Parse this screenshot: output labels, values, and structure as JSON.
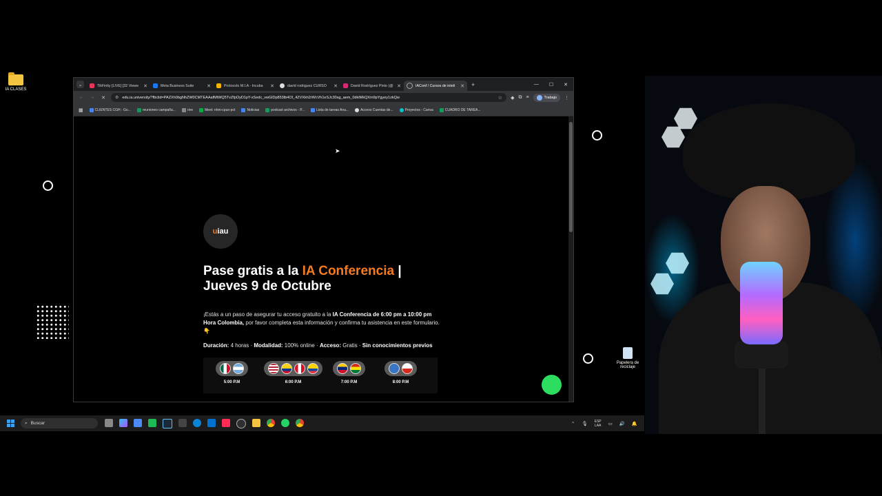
{
  "desktop": {
    "folder_label": "IA CLASES",
    "recycle_label": "Papelera de reciclaje"
  },
  "browser": {
    "tabs": [
      {
        "label": "TikFinity [LIVE] [32 Viewe",
        "color": "#e8335b"
      },
      {
        "label": "Meta Business Suite",
        "color": "#1877f2"
      },
      {
        "label": "Protocolo M.I.A - Incuba",
        "color": "#f5b400"
      },
      {
        "label": "david rodriguez CURSO",
        "color": "#dddddd"
      },
      {
        "label": "David Rodríguez Pinto (@",
        "color": "#d62976"
      },
      {
        "label": "IAConf / Cursos de inteli",
        "color": "#aaaaaa"
      }
    ],
    "address_url": "edu.ia.university/?fbclid=PAZXh0bgNhZW0CMTEAAafMtWQ5TvZfpOyD1pY-xSedc_vwGlDp853tb4OI_4ZVXkh2rWcVh1eSJc30sg_aem_0dkIMkQXm9pYgyey1zkQw",
    "profile_label": "Trabajo",
    "bookmarks": [
      {
        "label": "CLIENTES CGH - Go...",
        "color": "#4285f4"
      },
      {
        "label": "reuniones campaña...",
        "color": "#0f9d58"
      },
      {
        "label": "rive",
        "color": "#888888"
      },
      {
        "label": "Meet: nhm-cpuo-pct",
        "color": "#00ac47"
      },
      {
        "label": "Noticias",
        "color": "#4285f4"
      },
      {
        "label": "podcast archivos - P...",
        "color": "#0f9d58"
      },
      {
        "label": "Lista de tareas Ana...",
        "color": "#4285f4"
      },
      {
        "label": "Acceso Cuentas de...",
        "color": "#dddddd"
      },
      {
        "label": "Proyectos - Canva",
        "color": "#00c4cc"
      },
      {
        "label": "CUADRO DE TAREA...",
        "color": "#0f9d58"
      }
    ]
  },
  "page": {
    "logo_prefix": "u",
    "logo_suffix": "iau",
    "headline_before": "Pase gratis a la ",
    "headline_accent": "IA Conferencia",
    "headline_after": " |",
    "headline_line2": "Jueves 9 de Octubre",
    "para_p1": "¡Estás a un paso de asegurar tu acceso gratuito a la ",
    "para_b1": "IA Conferencia de 6:00 pm a 10:00 pm Hora Colombia,",
    "para_p2": " por favor completa esta información y confirma tu asistencia en este formulario. 👇",
    "duration_label": "Duración:",
    "duration_value": " 4 horas · ",
    "modality_label": "Modalidad:",
    "modality_value": " 100% online · ",
    "access_label": "Acceso:",
    "access_value": " Gratis · ",
    "no_knowledge": "Sin conocimientos previos",
    "time_groups": [
      {
        "time": "5:00 P.M",
        "flags": [
          "#ffffff",
          "#74acdf"
        ]
      },
      {
        "time": "6:00 P.M",
        "flags": [
          "#b22234",
          "#fcd116",
          "#d91023",
          "#ffd100"
        ]
      },
      {
        "time": "7:00 P.M",
        "flags": [
          "#ffcc00",
          "#d52b1e"
        ]
      },
      {
        "time": "8:00 P.M",
        "flags": [
          "#3a75c4",
          "#d52b1e"
        ]
      }
    ]
  },
  "taskbar": {
    "search_placeholder": "Buscar",
    "lang_line1": "ESP",
    "lang_line2": "LAA"
  }
}
